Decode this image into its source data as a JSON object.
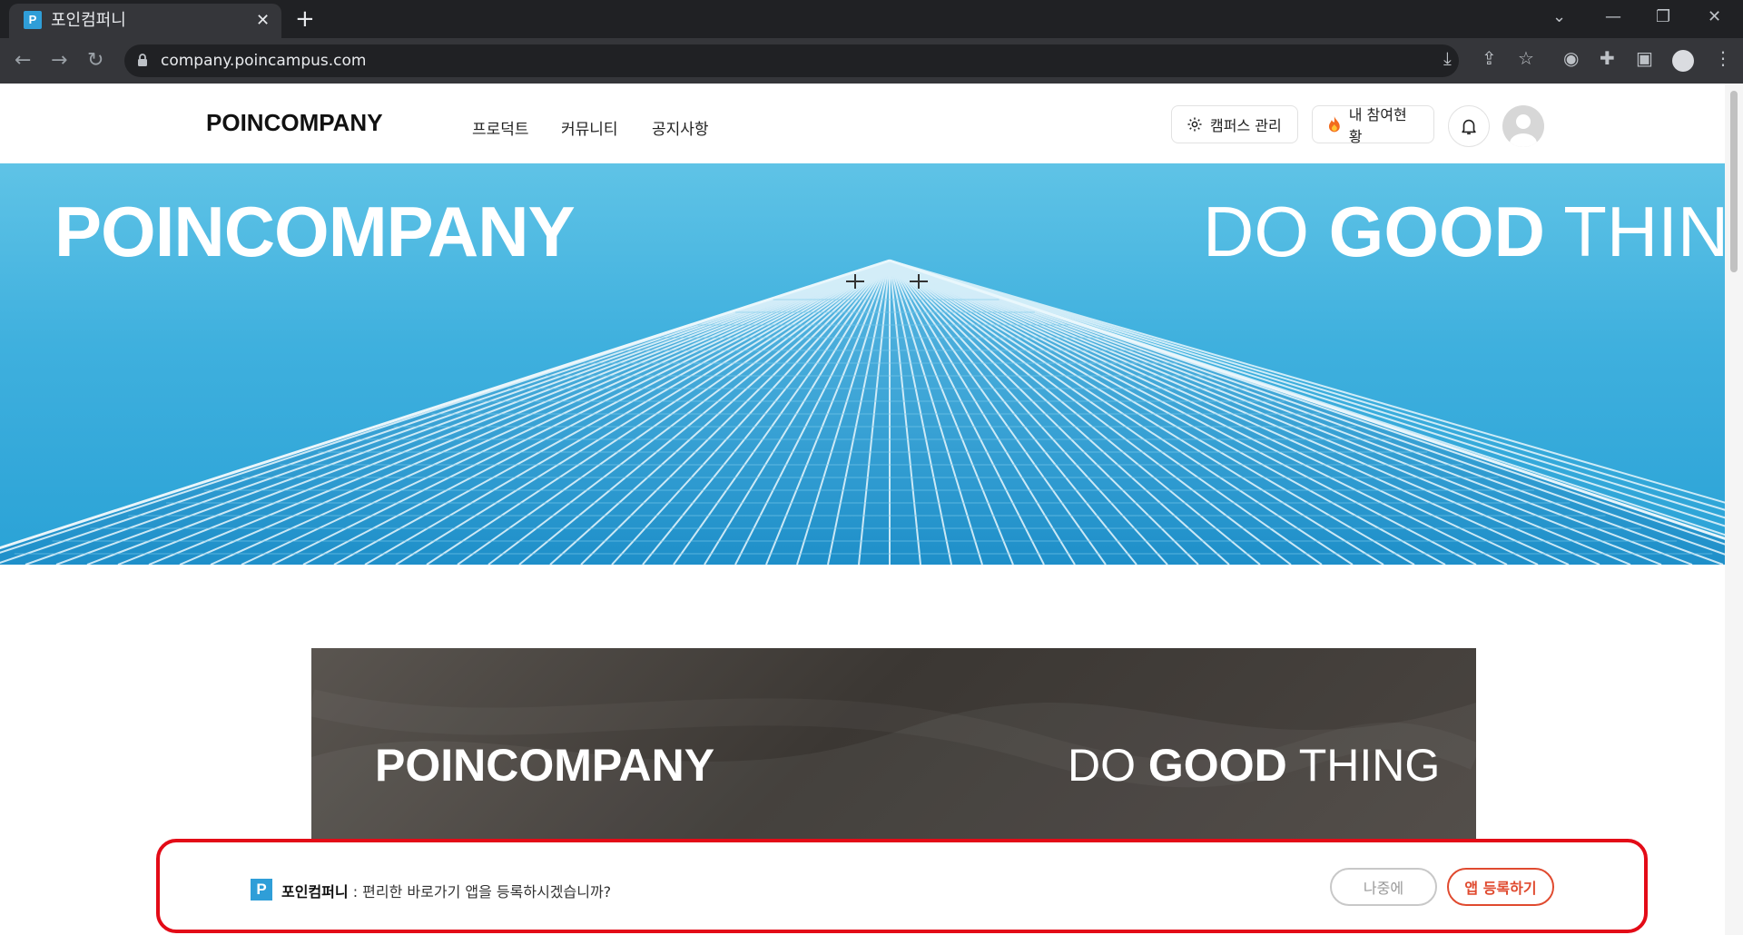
{
  "browser": {
    "tab_title": "포인컴퍼니",
    "tab_favicon": "P",
    "url": "company.poincampus.com",
    "icons": [
      "back-icon",
      "forward-icon",
      "reload-icon",
      "lock-icon",
      "install-icon",
      "share-icon",
      "bookmark-star-icon",
      "camera-icon",
      "extensions-icon",
      "sidepanel-icon",
      "profile-icon",
      "menu-icon"
    ]
  },
  "header": {
    "logo": "POINCOMPANY",
    "nav": [
      "프로덕트",
      "커뮤니티",
      "공지사항"
    ],
    "campus_manage": "캠퍼스 관리",
    "my_participation": "내 참여현황"
  },
  "hero": {
    "title": "POINCOMPANY",
    "slogan_do": "DO ",
    "slogan_good": "GOOD",
    "slogan_thing": " THING"
  },
  "banner": {
    "title": "POINCOMPANY",
    "slogan_do": "DO ",
    "slogan_good": "GOOD",
    "slogan_thing": " THING"
  },
  "install_prompt": {
    "logo": "P",
    "app_name": "포인컴퍼니",
    "message": " : 편리한 바로가기 앱을 등록하시겠습니까?",
    "later": "나중에",
    "install": "앱 등록하기",
    "highlight_color": "#e30b17"
  }
}
